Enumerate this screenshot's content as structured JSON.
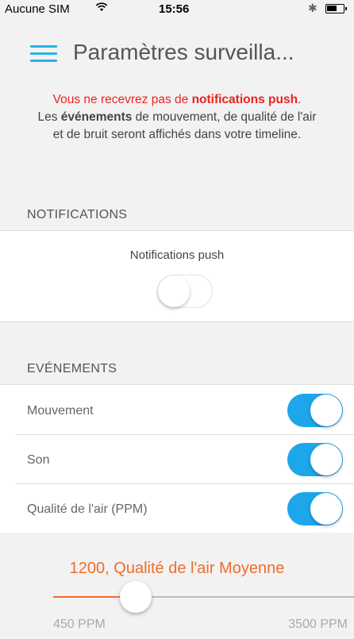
{
  "status_bar": {
    "carrier": "Aucune SIM",
    "wifi_icon": "wifi-icon",
    "time": "15:56",
    "bluetooth_icon": "bluetooth-icon",
    "battery_icon": "battery-icon"
  },
  "header": {
    "menu_icon": "hamburger-menu-icon",
    "title": "Paramètres surveilla..."
  },
  "warning": {
    "line1_prefix": "Vous ne recevrez pas de ",
    "line1_bold": "notifications push",
    "line1_suffix": ".",
    "line2_prefix": "Les ",
    "line2_bold": "événements",
    "line2_suffix": "  de mouvement, de qualité de l'air",
    "line3": "et de bruit seront affichés dans votre timeline."
  },
  "notifications": {
    "section_label": "NOTIFICATIONS",
    "push_label": "Notifications push",
    "push_enabled": false
  },
  "events": {
    "section_label": "EVÉNEMENTS",
    "items": [
      {
        "label": "Mouvement",
        "enabled": true
      },
      {
        "label": "Son",
        "enabled": true
      },
      {
        "label": "Qualité de l'air  (PPM)",
        "enabled": true
      }
    ]
  },
  "air_quality_slider": {
    "title": "1200, Qualité de l'air Moyenne",
    "value": 1200,
    "min_label": "450 PPM",
    "max_label": "3500 PPM",
    "min": 450,
    "max": 3500
  },
  "colors": {
    "accent_blue": "#1ea6ea",
    "warning_red": "#e22222",
    "slider_orange": "#f06c2a"
  }
}
